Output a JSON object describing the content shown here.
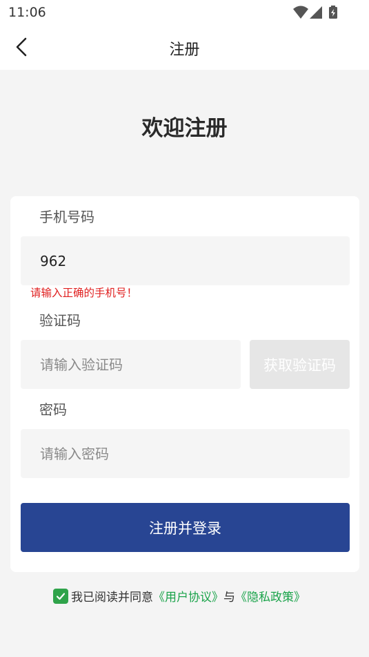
{
  "status_bar": {
    "time": "11:06",
    "icons": [
      "wifi-icon",
      "signal-icon",
      "battery-charging-icon"
    ]
  },
  "nav": {
    "title": "注册",
    "back_icon": "chevron-left-icon"
  },
  "welcome_title": "欢迎注册",
  "form": {
    "phone": {
      "label": "手机号码",
      "value": "962",
      "error": "请输入正确的手机号！"
    },
    "code": {
      "label": "验证码",
      "placeholder": "请输入验证码",
      "button_label": "获取验证码"
    },
    "password": {
      "label": "密码",
      "placeholder": "请输入密码"
    },
    "submit_label": "注册并登录"
  },
  "agreement": {
    "checked": true,
    "prefix": "我已阅读并同意",
    "user_agreement": "《用户协议》",
    "connector": "与",
    "privacy_policy": "《隐私政策》"
  },
  "colors": {
    "primary": "#284593",
    "error": "#e02020",
    "link": "#1aa34a",
    "checkbox": "#2fa34a",
    "disabled_button": "#e6e6e6"
  }
}
